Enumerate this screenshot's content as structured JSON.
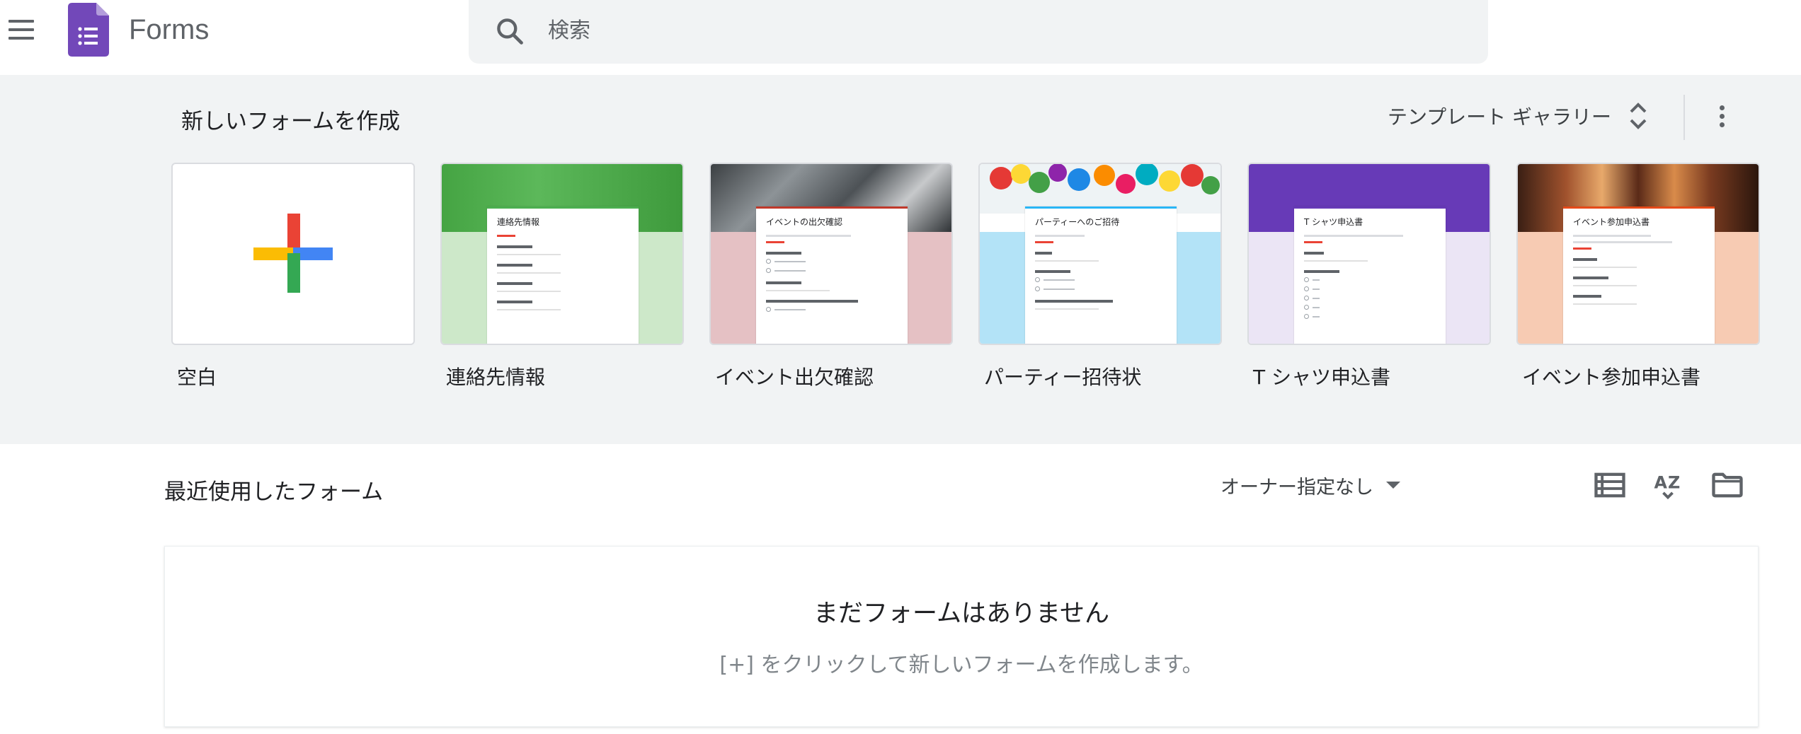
{
  "header": {
    "app_title": "Forms",
    "search_placeholder": "検索",
    "icons": {
      "menu": "hamburger-icon",
      "logo": "forms-logo-icon",
      "search": "search-icon"
    },
    "colors": {
      "logo_purple": "#7248b9",
      "search_bg": "#f1f3f4"
    }
  },
  "templates": {
    "title": "新しいフォームを作成",
    "gallery_label": "テンプレート ギャラリー",
    "items": [
      {
        "label": "空白"
      },
      {
        "label": "連絡先情報",
        "form_title": "連絡先情報"
      },
      {
        "label": "イベント出欠確認",
        "form_title": "イベントの出欠確認"
      },
      {
        "label": "パーティー招待状",
        "form_title": "パーティーへのご招待"
      },
      {
        "label": "T シャツ申込書",
        "form_title": "T シャツ申込書"
      },
      {
        "label": "イベント参加申込書",
        "form_title": "イベント参加申込書"
      }
    ],
    "colors": {
      "band_bg": "#f1f3f4",
      "plus_red": "#ea4335",
      "plus_blue": "#4285f4",
      "plus_yellow": "#fbbc04",
      "plus_green": "#34a853"
    }
  },
  "recent": {
    "title": "最近使用したフォーム",
    "owner_filter": "オーナー指定なし",
    "empty_title": "まだフォームはありません",
    "empty_subtitle": "[+] をクリックして新しいフォームを作成します。",
    "icons": {
      "list_view": "list-view-icon",
      "sort": "sort-az-icon",
      "folder": "folder-icon"
    }
  }
}
